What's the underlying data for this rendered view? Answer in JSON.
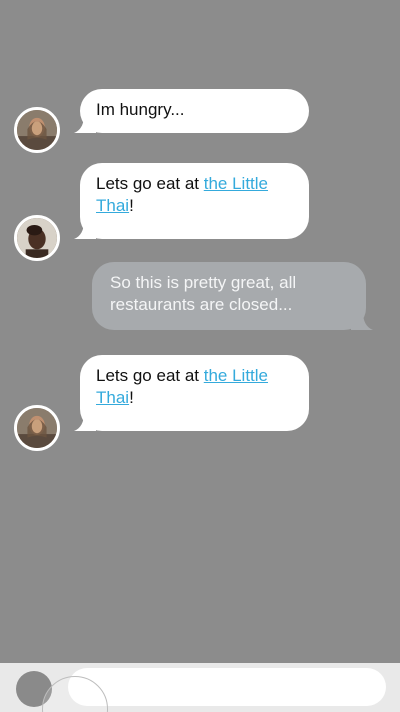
{
  "messages": [
    {
      "text": "Im hungry..."
    },
    {
      "prefix": "Lets go eat at ",
      "link": "the Little Thai",
      "suffix": "!"
    },
    {
      "text": "So this is pretty great, all restaurants are closed..."
    },
    {
      "prefix": "Lets go eat at ",
      "link": "the Little Thai",
      "suffix": "!"
    }
  ],
  "input": {
    "placeholder": "",
    "value": ""
  },
  "colors": {
    "background": "#8c8c8c",
    "incoming_bubble": "#ffffff",
    "outgoing_bubble": "#a7aaad",
    "link": "#34aadc",
    "input_bar": "#e9e9e9"
  }
}
